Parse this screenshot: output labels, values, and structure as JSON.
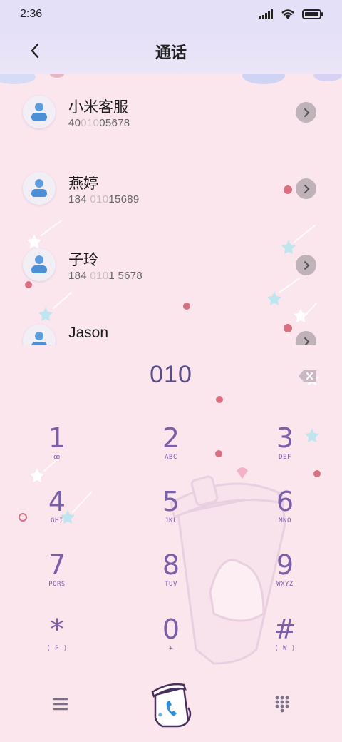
{
  "status_bar": {
    "time": "2:36"
  },
  "header": {
    "title": "通话"
  },
  "contacts": [
    {
      "name": "小米客服",
      "number_pre": "40",
      "number_match": "010",
      "number_post": "05678"
    },
    {
      "name": "燕婷",
      "number_pre": "184 ",
      "number_match": "010",
      "number_post": "15689"
    },
    {
      "name": "子玲",
      "number_pre": "184 ",
      "number_match": "010",
      "number_post": "1 5678"
    },
    {
      "name": "Jason",
      "number_pre": "",
      "number_match": "",
      "number_post": ""
    }
  ],
  "dialer": {
    "input_value": "010",
    "keys": [
      {
        "digit": "1",
        "letters": "ꝏ"
      },
      {
        "digit": "2",
        "letters": "ABC"
      },
      {
        "digit": "3",
        "letters": "DEF"
      },
      {
        "digit": "4",
        "letters": "GHI"
      },
      {
        "digit": "5",
        "letters": "JKL"
      },
      {
        "digit": "6",
        "letters": "MNO"
      },
      {
        "digit": "7",
        "letters": "PQRS"
      },
      {
        "digit": "8",
        "letters": "TUV"
      },
      {
        "digit": "9",
        "letters": "WXYZ"
      },
      {
        "digit": "*",
        "letters": "( P )"
      },
      {
        "digit": "0",
        "letters": "+"
      },
      {
        "digit": "#",
        "letters": "( W )"
      }
    ]
  },
  "icons": {
    "back": "chevron-left-icon",
    "signal": "signal-icon",
    "wifi": "wifi-icon",
    "battery": "battery-icon",
    "info": "chevron-right-icon",
    "delete": "backspace-icon",
    "menu": "menu-icon",
    "call": "phone-call-icon",
    "keypad": "keypad-icon"
  },
  "colors": {
    "background": "#fbe6ee",
    "header": "#e4e0f8",
    "accent": "#7a5ea8",
    "avatar_blue": "#4d8fd6",
    "info_button": "#bfb2b8"
  }
}
